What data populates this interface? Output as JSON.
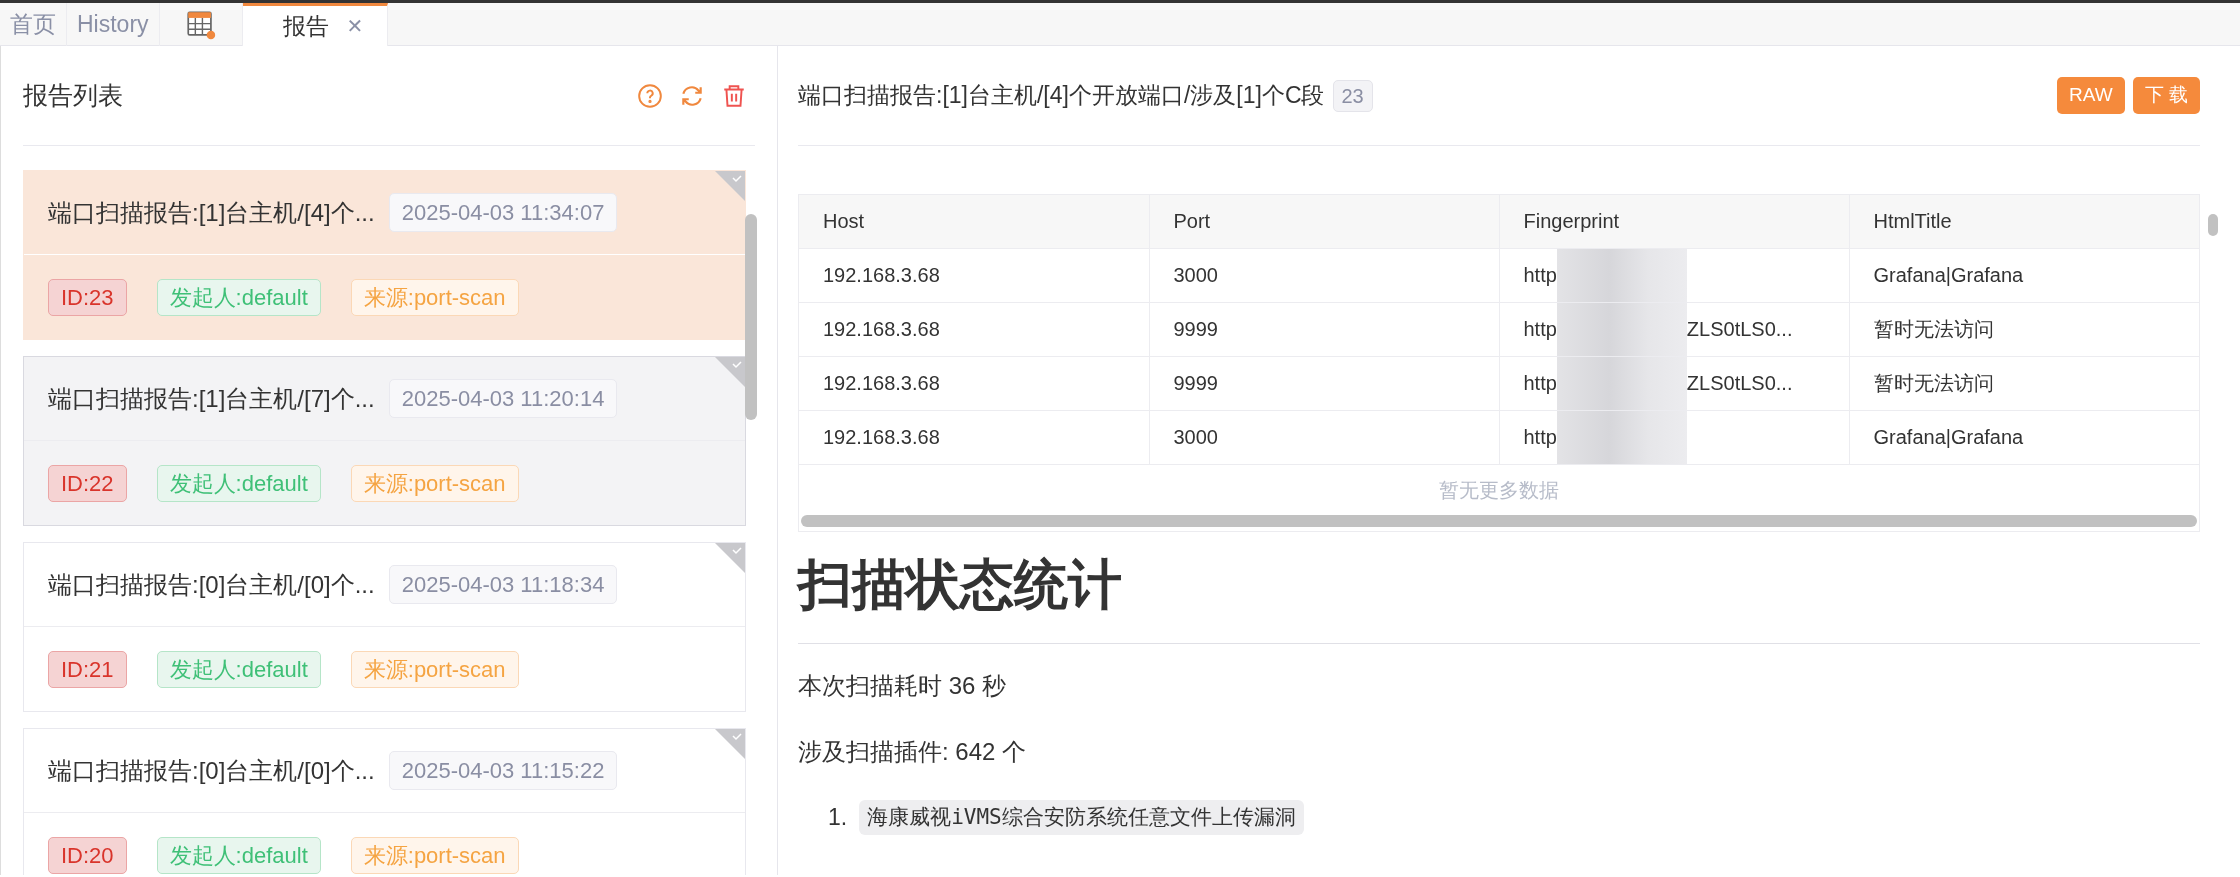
{
  "tabs": [
    {
      "kind": "text",
      "label": "首页",
      "selected": false
    },
    {
      "kind": "text",
      "label": "History",
      "selected": false
    },
    {
      "kind": "icon",
      "selected": false
    },
    {
      "kind": "text",
      "label": "报告",
      "selected": true,
      "close_label": "✕"
    }
  ],
  "report_list": {
    "title": "报告列表",
    "items": [
      {
        "title": "端口扫描报告:[1]台主机/[4]个...",
        "time": "2025-04-03 11:34:07",
        "id": "ID:23",
        "initiator": "发起人:default",
        "source": "来源:port-scan",
        "selected": true,
        "hovered": false
      },
      {
        "title": "端口扫描报告:[1]台主机/[7]个...",
        "time": "2025-04-03 11:20:14",
        "id": "ID:22",
        "initiator": "发起人:default",
        "source": "来源:port-scan",
        "selected": false,
        "hovered": true
      },
      {
        "title": "端口扫描报告:[0]台主机/[0]个...",
        "time": "2025-04-03 11:18:34",
        "id": "ID:21",
        "initiator": "发起人:default",
        "source": "来源:port-scan",
        "selected": false,
        "hovered": false
      },
      {
        "title": "端口扫描报告:[0]台主机/[0]个...",
        "time": "2025-04-03 11:15:22",
        "id": "ID:20",
        "initiator": "发起人:default",
        "source": "来源:port-scan",
        "selected": false,
        "hovered": false
      }
    ]
  },
  "report": {
    "title": "端口扫描报告:[1]台主机/[4]个开放端口/涉及[1]个C段",
    "count": "23",
    "buttons": [
      "RAW",
      "下 载"
    ],
    "table": {
      "columns": [
        "Host",
        "Port",
        "Fingerprint",
        "HtmlTitle"
      ],
      "rows": [
        {
          "host": "192.168.3.68",
          "port": "3000",
          "fingerprint_start": "http",
          "title": "Grafana|Grafana"
        },
        {
          "host": "192.168.3.68",
          "port": "9999",
          "fingerprint_start": "http",
          "fingerprint_end": "ZLS0tLS0...",
          "title": "暂时无法访问"
        },
        {
          "host": "192.168.3.68",
          "port": "9999",
          "fingerprint_start": "http",
          "fingerprint_end": "ZLS0tLS0...",
          "title": "暂时无法访问"
        },
        {
          "host": "192.168.3.68",
          "port": "3000",
          "fingerprint_start": "http",
          "title": "Grafana|Grafana"
        }
      ],
      "empty_text": "暂无更多数据"
    },
    "heading": "扫描状态统计",
    "paragraphs": [
      "本次扫描耗时 36 秒",
      "涉及扫描插件: 642 个"
    ],
    "plugins": [
      {
        "number": "1.",
        "name": "海康威视iVMS综合安防系统任意文件上传漏洞"
      }
    ]
  }
}
